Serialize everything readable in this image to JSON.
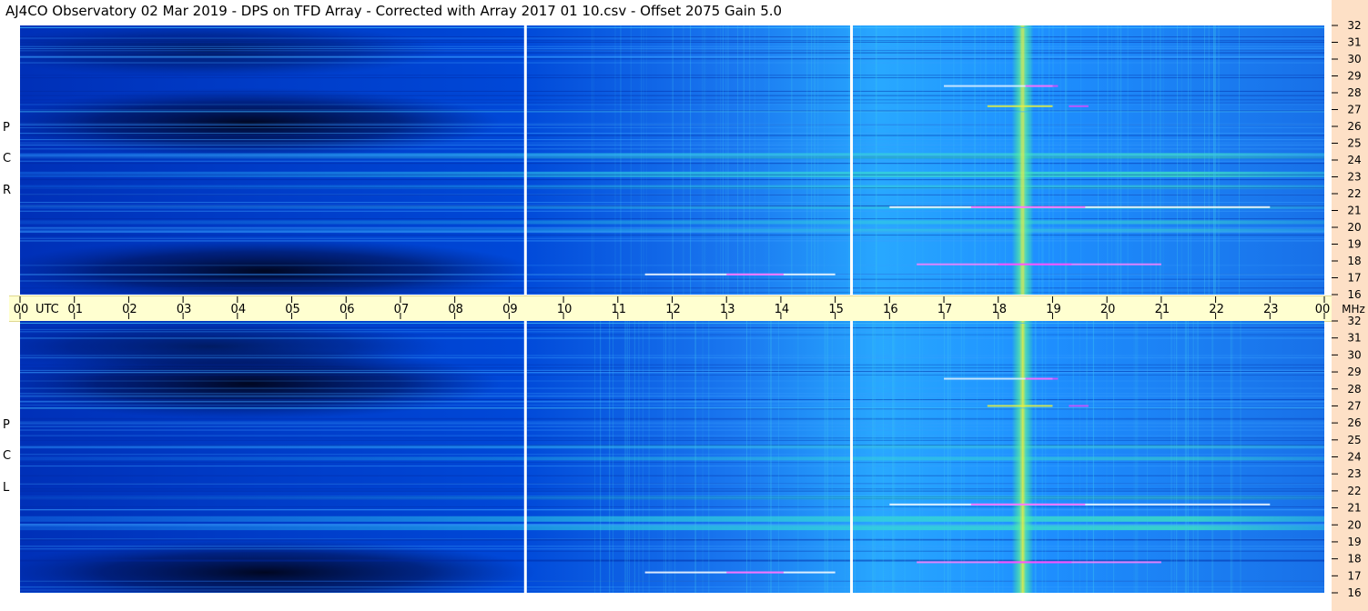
{
  "title": "AJ4CO Observatory  02 Mar 2019  -  DPS on TFD Array  -  Corrected with Array 2017 01 10.csv  -  Offset 2075  Gain 5.0",
  "chart_data": {
    "type": "heatmap",
    "panels": [
      {
        "name": "RCP",
        "letters": [
          "R",
          "C",
          "P"
        ]
      },
      {
        "name": "LCP",
        "letters": [
          "L",
          "C",
          "P"
        ]
      }
    ],
    "x_axis": {
      "unit_label": "UTC",
      "range": [
        0,
        24
      ],
      "tick_labels": [
        "00",
        "01",
        "02",
        "03",
        "04",
        "05",
        "06",
        "07",
        "08",
        "09",
        "10",
        "11",
        "12",
        "13",
        "14",
        "15",
        "16",
        "17",
        "18",
        "19",
        "20",
        "21",
        "22",
        "23",
        "00"
      ]
    },
    "y_axis": {
      "unit_label": "MHz",
      "range": [
        16,
        32
      ],
      "tick_labels": [
        "32",
        "31",
        "30",
        "29",
        "28",
        "27",
        "26",
        "25",
        "24",
        "23",
        "22",
        "21",
        "20",
        "19",
        "18",
        "17",
        "16"
      ]
    },
    "segment_dividers_utc": [
      9.3,
      15.3
    ],
    "colors": {
      "dark": "#000830",
      "low": "#0038c8",
      "mid": "#1e90ff",
      "high": "#30e0d0",
      "peak": "#e8f040",
      "saturated": "#ff40ff"
    }
  }
}
